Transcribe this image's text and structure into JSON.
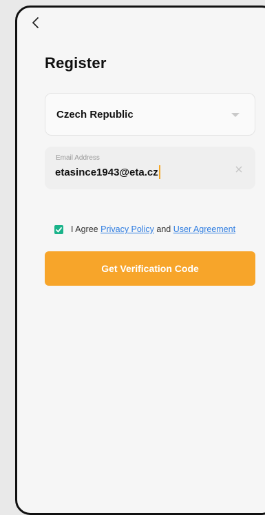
{
  "header": {
    "back_icon": "chevron-left-icon",
    "title": "Register"
  },
  "country": {
    "value": "Czech Republic",
    "caret_icon": "caret-down-icon"
  },
  "email": {
    "label": "Email Address",
    "value": "etasince1943@eta.cz",
    "clear_icon": "close-icon"
  },
  "agreement": {
    "checked": true,
    "checkbox_color": "#1ab38a",
    "prefix": "I Agree",
    "privacy_link": "Privacy Policy",
    "conjunction": "and",
    "user_link": "User Agreement"
  },
  "actions": {
    "verify_label": "Get Verification Code",
    "verify_color": "#f7a52a"
  },
  "colors": {
    "link": "#2f7de1",
    "cursor": "#f5a623"
  }
}
